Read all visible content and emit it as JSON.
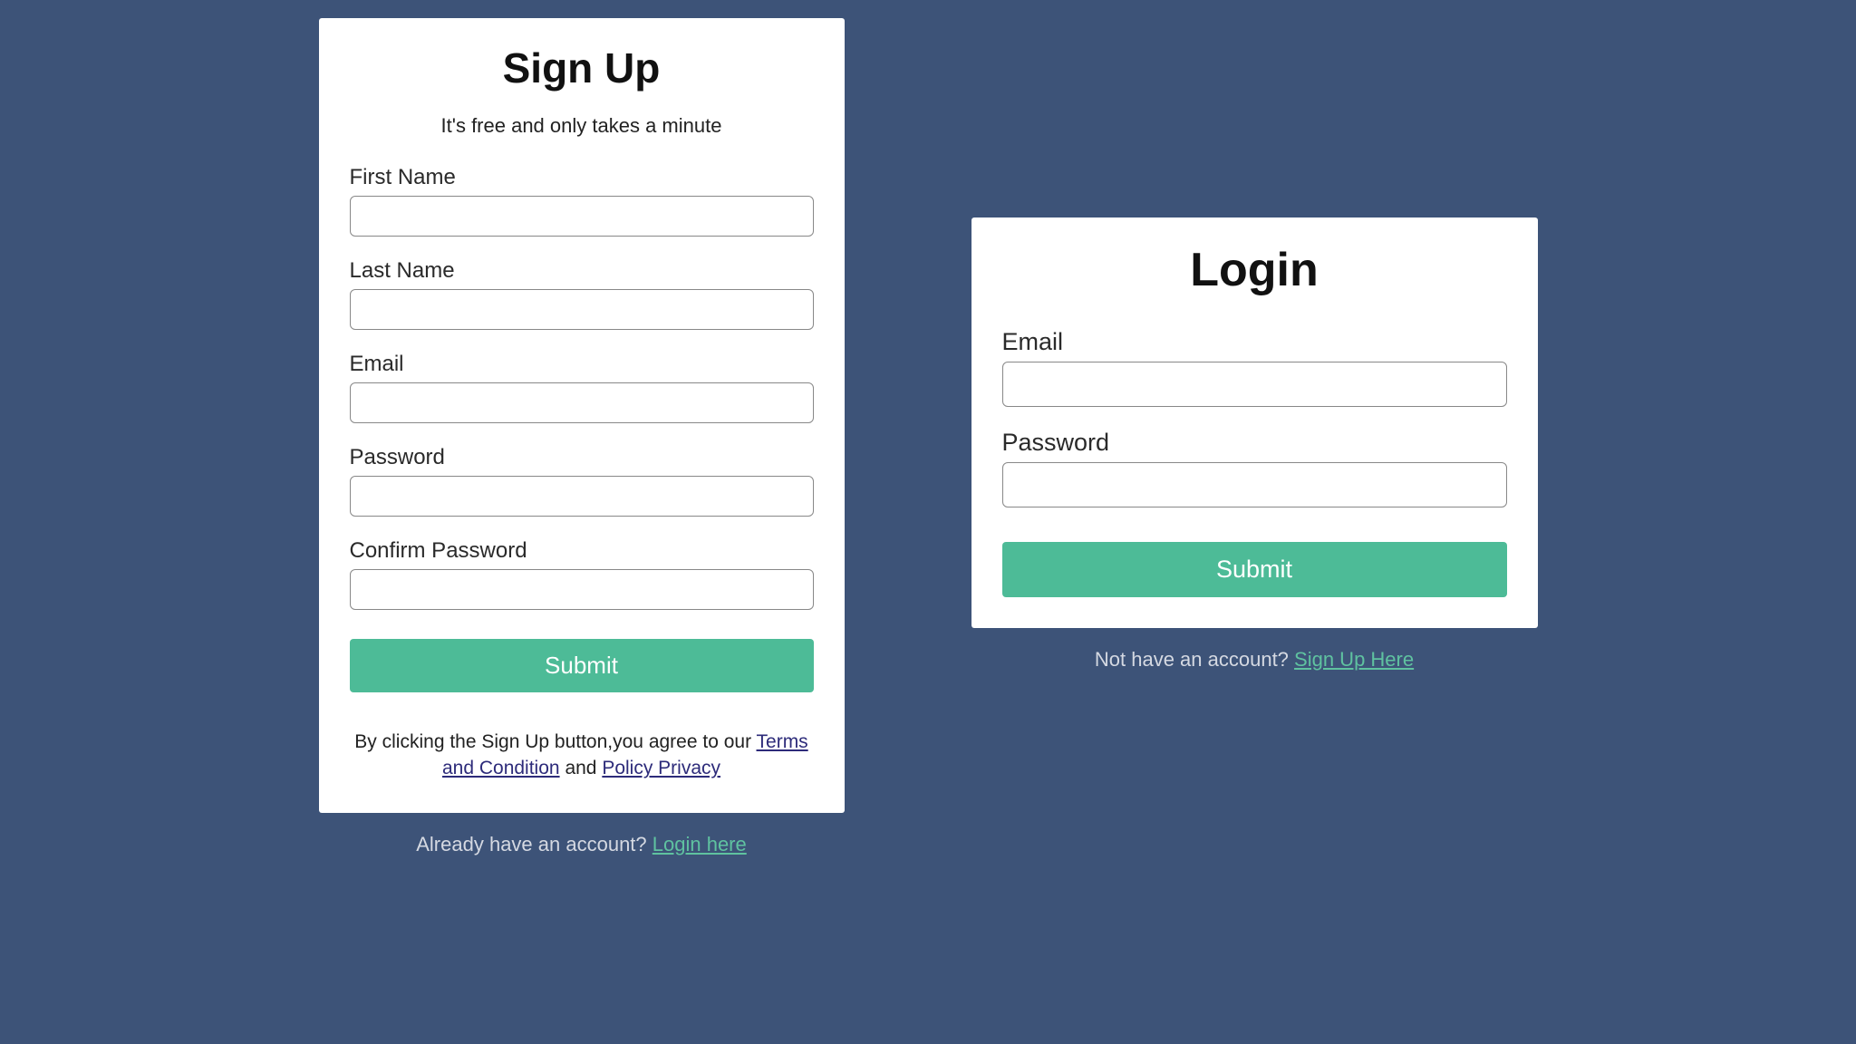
{
  "signup": {
    "title": "Sign Up",
    "subtitle": "It's free and only takes a minute",
    "fields": {
      "first_name_label": "First Name",
      "last_name_label": "Last Name",
      "email_label": "Email",
      "password_label": "Password",
      "confirm_password_label": "Confirm Password"
    },
    "submit_label": "Submit",
    "legal_prefix": "By clicking the Sign Up button,you agree to our ",
    "terms_link": "Terms and Condition",
    "legal_and": " and ",
    "privacy_link": "Policy Privacy",
    "below_text": "Already have an account? ",
    "below_link": "Login here"
  },
  "login": {
    "title": "Login",
    "fields": {
      "email_label": "Email",
      "password_label": "Password"
    },
    "submit_label": "Submit",
    "below_text": "Not have an account? ",
    "below_link": "Sign Up Here"
  }
}
